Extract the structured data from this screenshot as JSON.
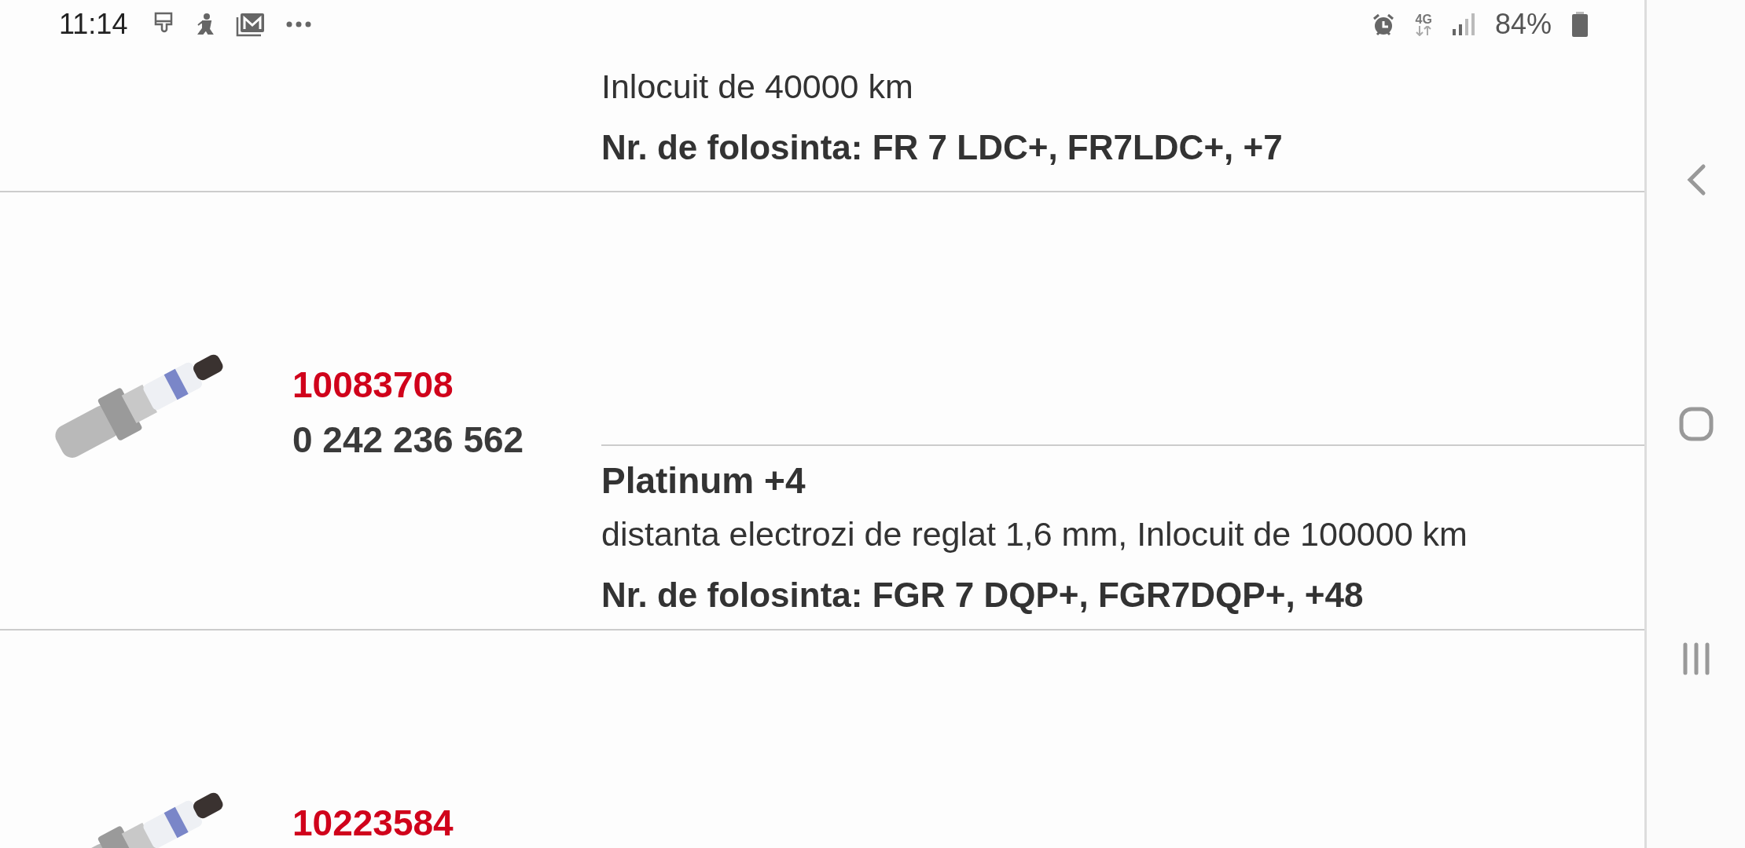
{
  "status_bar": {
    "time": "11:14",
    "network": "4G",
    "battery": "84%"
  },
  "products": [
    {
      "description": "Inlocuit de 40000 km",
      "usage": "Nr. de folosinta: FR 7 LDC+, FR7LDC+, +7"
    },
    {
      "code": "10083708",
      "part_number": "0 242 236 562",
      "title": "Platinum +4",
      "description": "distanta electrozi de reglat 1,6 mm, Inlocuit de 100000 km",
      "usage": "Nr. de folosinta: FGR 7 DQP+, FGR7DQP+, +48"
    },
    {
      "code": "10223584"
    }
  ]
}
